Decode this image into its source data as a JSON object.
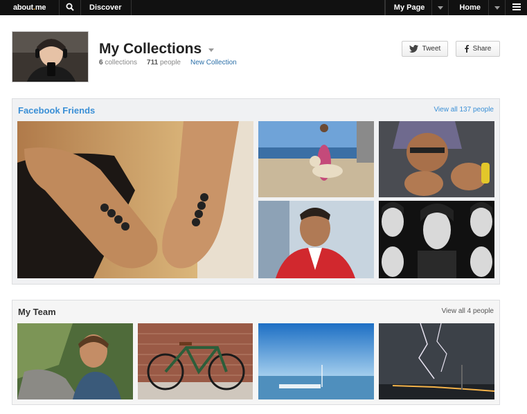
{
  "topbar": {
    "logo_main": "about",
    "logo_dot": ".",
    "logo_suffix": "me",
    "discover": "Discover",
    "mypage": "My Page",
    "home": "Home"
  },
  "header": {
    "title": "My Collections",
    "collections_count": "6",
    "collections_label": "collections",
    "people_count": "711",
    "people_label": "people",
    "new_collection": "New Collection",
    "tweet": "Tweet",
    "share": "Share"
  },
  "collections": [
    {
      "title": "Facebook Friends",
      "view_all": "View all 137 people"
    },
    {
      "title": "My Team",
      "view_all": "View all 4 people"
    }
  ],
  "colors": {
    "accent_blue": "#3a8fd6",
    "link_blue": "#2b6fa8",
    "topbar": "#111111",
    "logo_dot": "#f6a623"
  },
  "icons": [
    "search-icon",
    "chevron-down-icon",
    "menu-icon",
    "twitter-icon",
    "facebook-icon"
  ]
}
